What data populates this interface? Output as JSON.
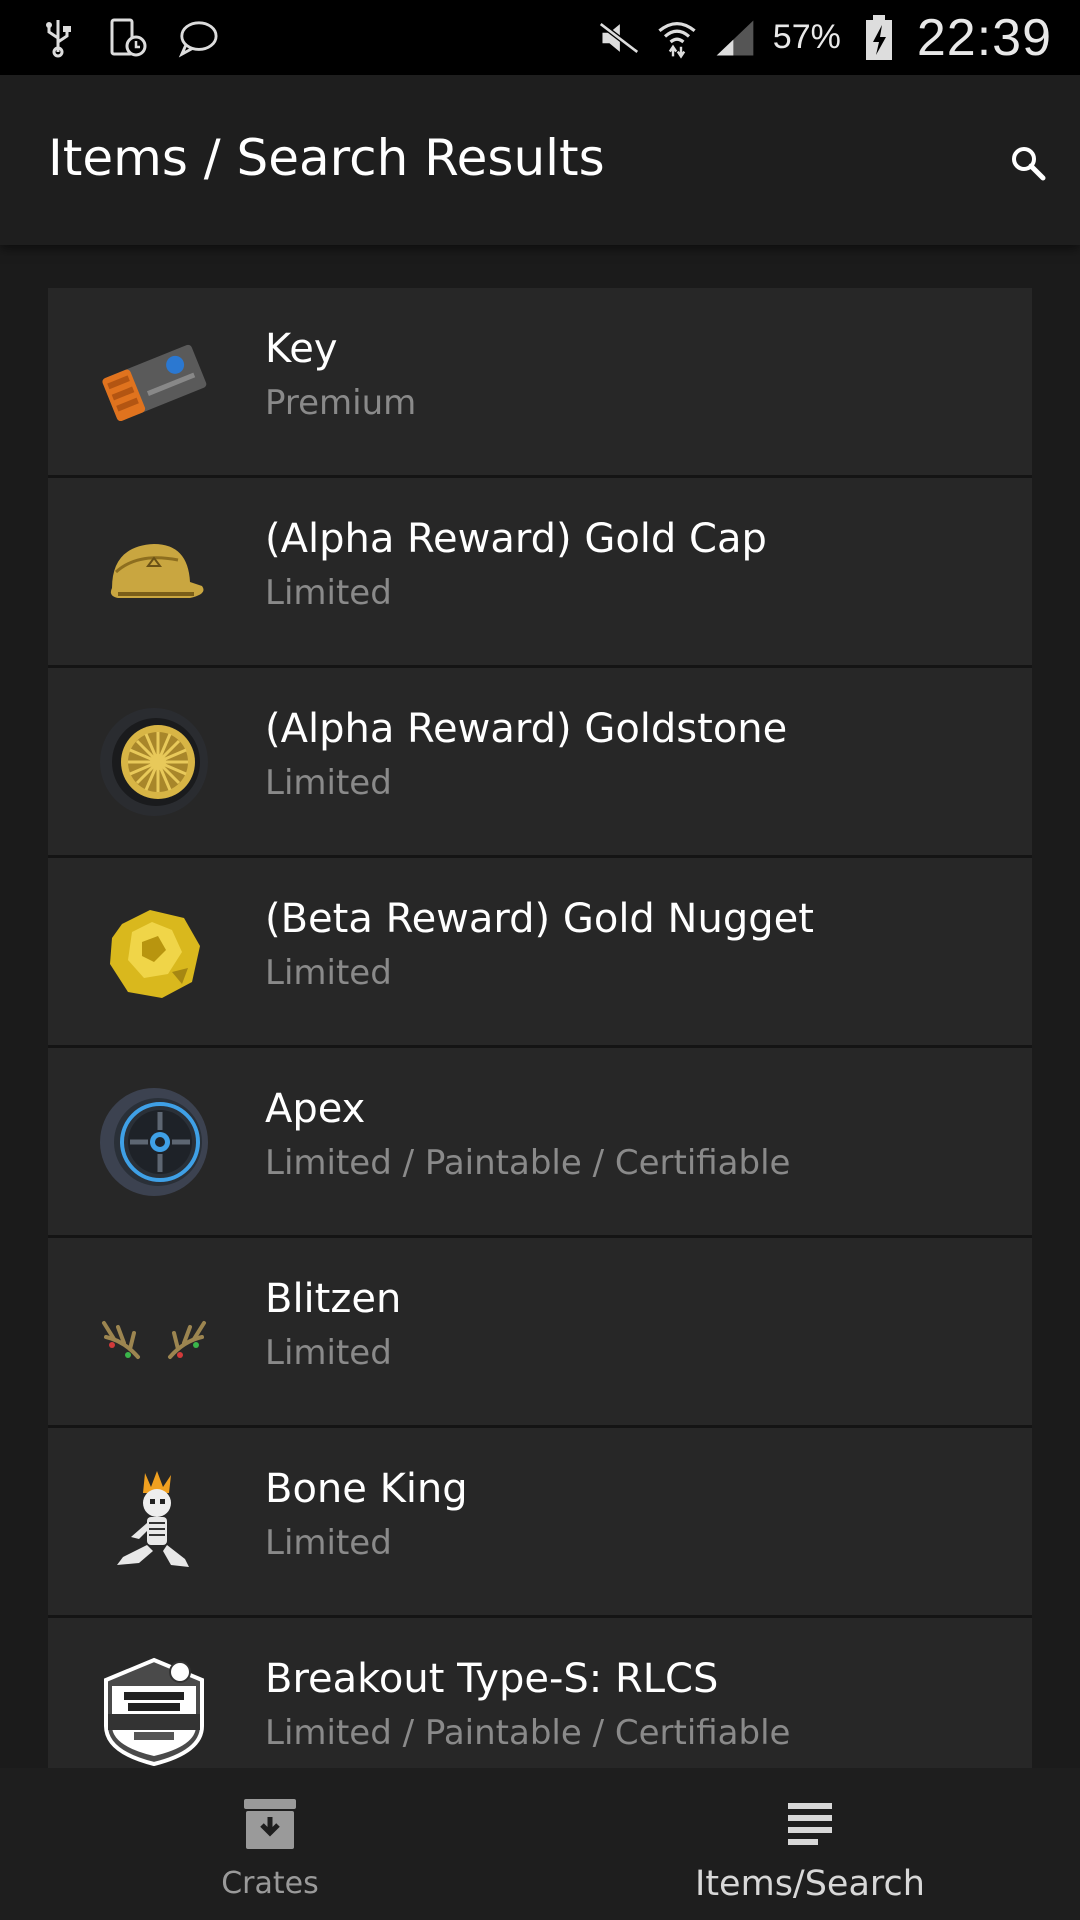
{
  "status_bar": {
    "battery_percent": "57%",
    "clock": "22:39"
  },
  "app_bar": {
    "title": "Items / Search Results"
  },
  "items": [
    {
      "name": "Key",
      "subtitle": "Premium",
      "icon": "key-icon"
    },
    {
      "name": "(Alpha Reward) Gold Cap",
      "subtitle": "Limited",
      "icon": "gold-cap-icon"
    },
    {
      "name": "(Alpha Reward) Goldstone",
      "subtitle": "Limited",
      "icon": "goldstone-wheel-icon"
    },
    {
      "name": "(Beta Reward) Gold Nugget",
      "subtitle": "Limited",
      "icon": "gold-nugget-icon"
    },
    {
      "name": "Apex",
      "subtitle": "Limited / Paintable / Certifiable",
      "icon": "apex-wheel-icon"
    },
    {
      "name": "Blitzen",
      "subtitle": "Limited",
      "icon": "antlers-icon"
    },
    {
      "name": "Bone King",
      "subtitle": "Limited",
      "icon": "bone-king-icon"
    },
    {
      "name": "Breakout Type-S: RLCS",
      "subtitle": "Limited / Paintable / Certifiable",
      "icon": "rlcs-logo-icon"
    }
  ],
  "bottom_nav": {
    "crates_label": "Crates",
    "items_search_label": "Items/Search",
    "active": "Items/Search"
  },
  "colors": {
    "background": "#1b1b1b",
    "list_item": "#272727",
    "subtitle": "#8a8a8a"
  }
}
